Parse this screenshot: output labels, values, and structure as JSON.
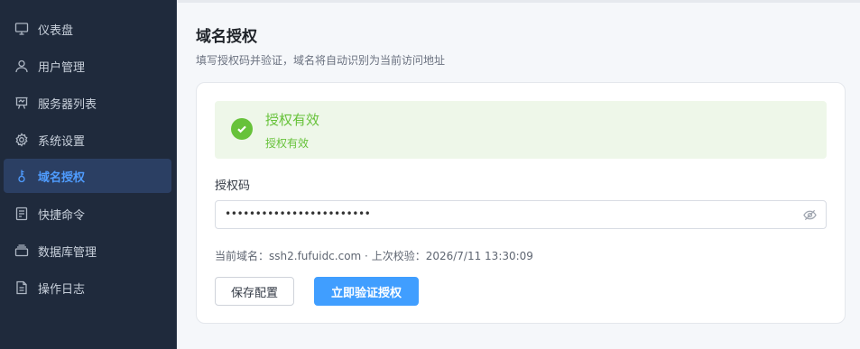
{
  "sidebar": {
    "items": [
      {
        "label": "仪表盘",
        "icon": "monitor-icon"
      },
      {
        "label": "用户管理",
        "icon": "user-icon"
      },
      {
        "label": "服务器列表",
        "icon": "server-icon"
      },
      {
        "label": "系统设置",
        "icon": "gear-icon"
      },
      {
        "label": "域名授权",
        "icon": "key-icon",
        "active": true
      },
      {
        "label": "快捷命令",
        "icon": "document-icon"
      },
      {
        "label": "数据库管理",
        "icon": "database-icon"
      },
      {
        "label": "操作日志",
        "icon": "log-icon"
      }
    ]
  },
  "page": {
    "title": "域名授权",
    "description": "填写授权码并验证，域名将自动识别为当前访问地址"
  },
  "status": {
    "title": "授权有效",
    "description": "授权有效",
    "color": "#67c23a"
  },
  "form": {
    "code_label": "授权码",
    "code_value": "••••••••••••••••••••••••",
    "meta_domain_label": "当前域名：",
    "meta_domain_value": "ssh2.fufuidc.com",
    "meta_separator": " · ",
    "meta_check_label": "上次校验：",
    "meta_check_value": "2026/7/11 13:30:09",
    "save_label": "保存配置",
    "verify_label": "立即验证授权"
  },
  "colors": {
    "sidebar_bg": "#1f2a3c",
    "accent": "#409eff",
    "success": "#67c23a"
  }
}
